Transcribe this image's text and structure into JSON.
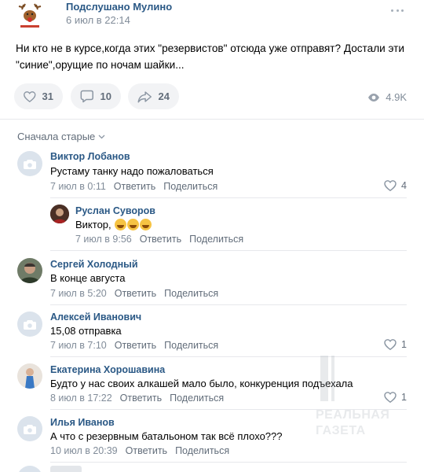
{
  "post": {
    "author": "Подслушано Мулино",
    "date": "6 июл в 22:14",
    "text": "Ни кто не в курсе,когда этих \"резервистов\" отсюда уже отправят? Достали эти \"синие\",орущие по ночам шайки...",
    "likes": "31",
    "comments": "10",
    "shares": "24",
    "views": "4.9K"
  },
  "sort_label": "Сначала старые",
  "actions": {
    "reply": "Ответить",
    "share": "Поделиться"
  },
  "comments": [
    {
      "name": "Виктор Лобанов",
      "text": "Рустаму танку надо пожаловаться",
      "date": "7 июл в 0:11",
      "likes": "4"
    },
    {
      "name": "Руслан Суворов",
      "text": "Виктор,",
      "date": "7 июл в 9:56",
      "likes": ""
    },
    {
      "name": "Сергей Холодный",
      "text": "В конце августа",
      "date": "7 июл в 5:20",
      "likes": ""
    },
    {
      "name": "Алексей Иванович",
      "text": "15,08 отправка",
      "date": "7 июл в 7:10",
      "likes": "1"
    },
    {
      "name": "Екатерина Хорошавина",
      "text": "Будто у нас своих алкашей мало было, конкуренция подъехала",
      "date": "8 июл в 17:22",
      "likes": "1"
    },
    {
      "name": "Илья Иванов",
      "text": "А что с резервным батальоном так всё плохо???",
      "date": "10 июл в 20:39",
      "likes": ""
    }
  ],
  "watermark": {
    "line1": "РЕАЛЬНАЯ",
    "line2": "ГАЗЕТА"
  },
  "colors": {
    "link": "#2a5885",
    "secondary": "#818c99",
    "pill_bg": "#f2f3f5",
    "divider": "#e7e8ec"
  },
  "icons": [
    "like-heart-icon",
    "comment-bubble-icon",
    "share-arrow-icon",
    "eye-icon",
    "chevron-down-icon",
    "camera-placeholder-icon",
    "more-dots-icon"
  ]
}
